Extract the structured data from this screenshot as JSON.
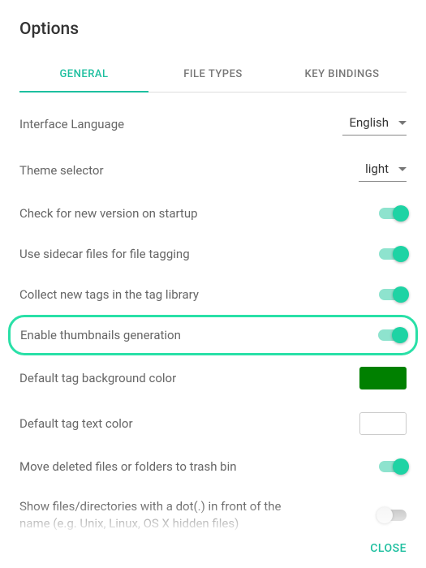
{
  "title": "Options",
  "tabs": {
    "general": "GENERAL",
    "filetypes": "FILE TYPES",
    "keybindings": "KEY BINDINGS"
  },
  "options": {
    "language": {
      "label": "Interface Language",
      "value": "English"
    },
    "theme": {
      "label": "Theme selector",
      "value": "light"
    },
    "checkUpdate": {
      "label": "Check for new version on startup"
    },
    "sidecar": {
      "label": "Use sidecar files for file tagging"
    },
    "collectTags": {
      "label": "Collect new tags in the tag library"
    },
    "thumbnails": {
      "label": "Enable thumbnails generation"
    },
    "tagBg": {
      "label": "Default tag background color",
      "color": "#008000"
    },
    "tagText": {
      "label": "Default tag text color",
      "color": "#ffffff"
    },
    "trash": {
      "label": "Move deleted files or folders to trash bin"
    },
    "hidden": {
      "label": "Show files/directories with a dot(.) in front of the name (e.g. Unix, Linux, OS X hidden files)"
    }
  },
  "footer": {
    "close": "CLOSE"
  }
}
